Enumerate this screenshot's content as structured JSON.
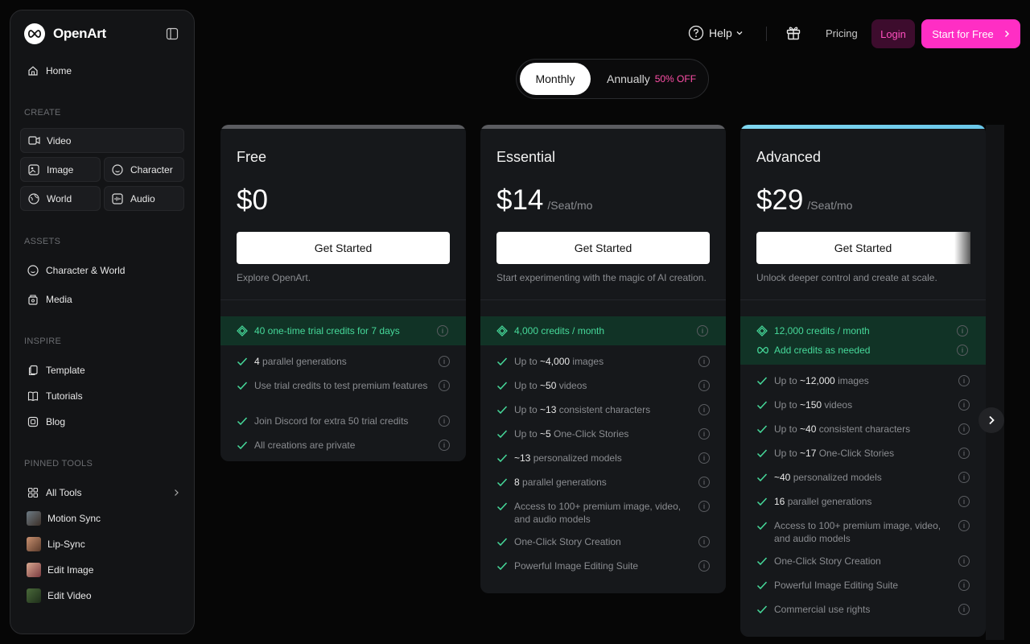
{
  "brand": {
    "name": "OpenArt"
  },
  "sidebar": {
    "home": "Home",
    "create_label": "CREATE",
    "create": {
      "video": "Video",
      "image": "Image",
      "character": "Character",
      "world": "World",
      "audio": "Audio"
    },
    "assets_label": "ASSETS",
    "assets": [
      "Character & World",
      "Media"
    ],
    "inspire_label": "INSPIRE",
    "inspire": [
      "Template",
      "Tutorials",
      "Blog"
    ],
    "pinned_label": "PINNED TOOLS",
    "pinned": [
      "All Tools",
      "Motion Sync",
      "Lip-Sync",
      "Edit Image",
      "Edit Video"
    ]
  },
  "header": {
    "help": "Help",
    "pricing": "Pricing",
    "login": "Login",
    "start": "Start for Free"
  },
  "billing": {
    "monthly": "Monthly",
    "annually": "Annually",
    "discount": "50% OFF"
  },
  "plans": [
    {
      "name": "Free",
      "price": "$0",
      "per": "",
      "cta": "Get Started",
      "desc": "Explore OpenArt.",
      "credits": [
        "40 one-time trial credits for 7 days"
      ],
      "features": [
        {
          "pre": "",
          "em": "4",
          "post": " parallel generations"
        },
        {
          "pre": "Use trial credits to test premium features",
          "em": "",
          "post": ""
        },
        {
          "pre": "Join Discord for extra 50 trial credits",
          "em": "",
          "post": ""
        },
        {
          "pre": "All creations are private",
          "em": "",
          "post": ""
        }
      ]
    },
    {
      "name": "Essential",
      "price": "$14",
      "per": "/Seat/mo",
      "cta": "Get Started",
      "desc": "Start experimenting with the magic of AI creation.",
      "credits": [
        "4,000 credits / month"
      ],
      "features": [
        {
          "pre": "Up to ",
          "em": "~4,000",
          "post": " images"
        },
        {
          "pre": "Up to ",
          "em": "~50",
          "post": " videos"
        },
        {
          "pre": "Up to ",
          "em": "~13",
          "post": " consistent characters"
        },
        {
          "pre": "Up to ",
          "em": "~5",
          "post": " One-Click Stories"
        },
        {
          "pre": "",
          "em": "~13",
          "post": " personalized models"
        },
        {
          "pre": "",
          "em": "8",
          "post": " parallel generations"
        },
        {
          "pre": "Access to 100+ premium image, video, and audio models",
          "em": "",
          "post": ""
        },
        {
          "pre": "One-Click Story Creation",
          "em": "",
          "post": ""
        },
        {
          "pre": "Powerful Image Editing Suite",
          "em": "",
          "post": ""
        }
      ]
    },
    {
      "name": "Advanced",
      "price": "$29",
      "per": "/Seat/mo",
      "cta": "Get Started",
      "desc": "Unlock deeper control and create at scale.",
      "credits": [
        "12,000 credits / month",
        "Add credits as needed"
      ],
      "features": [
        {
          "pre": "Up to ",
          "em": "~12,000",
          "post": " images"
        },
        {
          "pre": "Up to ",
          "em": "~150",
          "post": " videos"
        },
        {
          "pre": "Up to ",
          "em": "~40",
          "post": " consistent characters"
        },
        {
          "pre": "Up to ",
          "em": "~17",
          "post": " One-Click Stories"
        },
        {
          "pre": "",
          "em": "~40",
          "post": " personalized models"
        },
        {
          "pre": "",
          "em": "16",
          "post": " parallel generations"
        },
        {
          "pre": "Access to 100+ premium image, video, and audio models",
          "em": "",
          "post": ""
        },
        {
          "pre": "One-Click Story Creation",
          "em": "",
          "post": ""
        },
        {
          "pre": "Powerful Image Editing Suite",
          "em": "",
          "post": ""
        },
        {
          "pre": "Commercial use rights",
          "em": "",
          "post": ""
        }
      ]
    }
  ],
  "colors": {
    "accent_pink": "#ff2ec4",
    "credit_green": "#46d99a",
    "credit_bg": "#113326"
  }
}
